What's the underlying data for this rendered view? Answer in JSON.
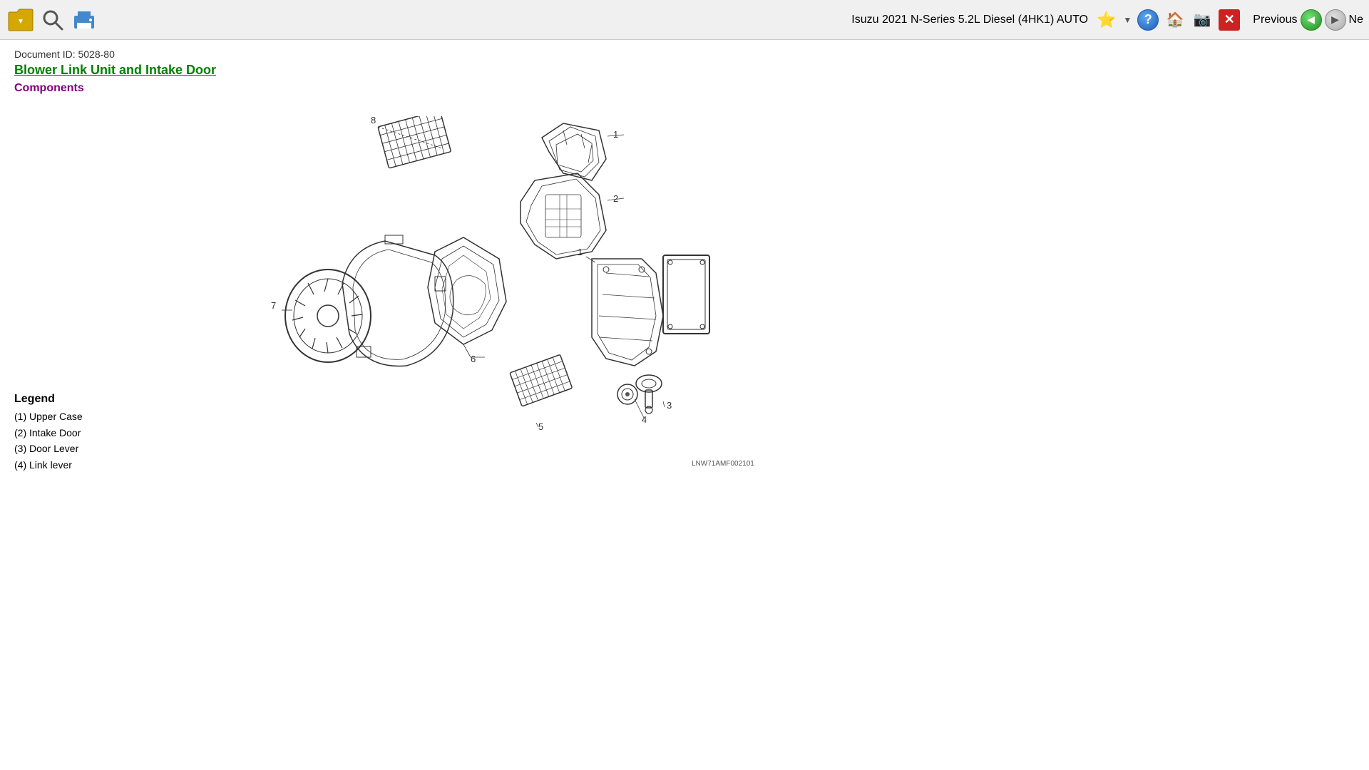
{
  "toolbar": {
    "vehicle_label": "Isuzu 2021 N-Series 5.2L Diesel (4HK1) AUTO",
    "previous_label": "Previous",
    "next_label": "Ne",
    "folder_icon": "folder-icon",
    "search_icon": "search-icon",
    "print_icon": "print-icon",
    "star_icon": "star-icon",
    "help_icon": "help-icon",
    "home_icon": "home-icon",
    "camera_icon": "camera-icon",
    "close_icon": "close-icon"
  },
  "document": {
    "id_label": "Document ID: 5028-80",
    "title": "Blower Link Unit and Intake Door",
    "section": "Components"
  },
  "diagram": {
    "image_label": "LNW71AMF002101",
    "labels": [
      "1",
      "2",
      "3",
      "4",
      "5",
      "6",
      "7",
      "8"
    ]
  },
  "legend": {
    "title": "Legend",
    "items": [
      "(1)  Upper Case",
      "(2)  Intake Door",
      "(3)  Door Lever",
      "(4)  Link lever"
    ]
  }
}
